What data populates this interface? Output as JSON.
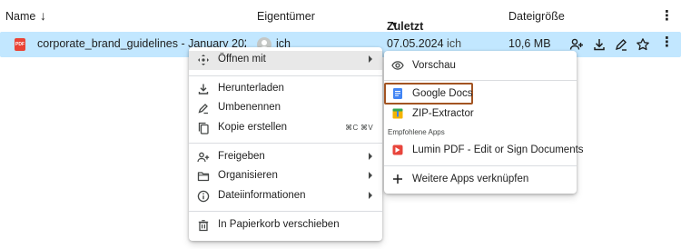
{
  "header": {
    "name_label": "Name",
    "sort_arrow": "↓",
    "owner_label": "Eigentümer",
    "modified_label": "Zuletzt geändert",
    "modified_caret": "▼",
    "size_label": "Dateigröße",
    "more_symbol": "⋮"
  },
  "file": {
    "type_badge": "PDF",
    "name": "corporate_brand_guidelines - January 2023 Upda...",
    "owner": "ich",
    "modified_date": "07.05.2024",
    "modified_by": "ich",
    "size": "10,6 MB",
    "more_symbol": "⋮",
    "actions": [
      "share-icon",
      "download-icon",
      "edit-icon",
      "star-icon",
      "more-vert-icon"
    ]
  },
  "context_menu": {
    "items": [
      {
        "label": "Öffnen mit",
        "icon": "open-with-icon",
        "submenu": true,
        "highlighted": true
      },
      {
        "label": "Herunterladen",
        "icon": "download-icon"
      },
      {
        "label": "Umbenennen",
        "icon": "rename-icon"
      },
      {
        "label": "Kopie erstellen",
        "icon": "copy-icon",
        "shortcut": "⌘C ⌘V"
      },
      {
        "label": "Freigeben",
        "icon": "share-icon",
        "submenu": true
      },
      {
        "label": "Organisieren",
        "icon": "folder-icon",
        "submenu": true
      },
      {
        "label": "Dateiinformationen",
        "icon": "info-icon",
        "submenu": true
      },
      {
        "label": "In Papierkorb verschieben",
        "icon": "trash-icon"
      }
    ]
  },
  "submenu": {
    "items": [
      {
        "label": "Vorschau",
        "icon": "eye-icon"
      },
      {
        "label": "Google Docs",
        "icon": "google-docs-icon",
        "outlined": true
      },
      {
        "label": "ZIP-Extractor",
        "icon": "zip-extractor-icon"
      },
      {
        "label": "Lumin PDF - Edit or Sign Documents",
        "icon": "lumin-pdf-icon"
      },
      {
        "label": "Weitere Apps verknüpfen",
        "icon": "plus-icon"
      }
    ],
    "caption": "Empfohlene Apps"
  },
  "colors": {
    "selected_row": "#c2e7ff",
    "menu_highlight": "#e8e8e8",
    "outline": "#a35422",
    "pdf_red": "#ea4335",
    "docs_blue": "#4285f4",
    "lumin_red": "#e8453c"
  }
}
